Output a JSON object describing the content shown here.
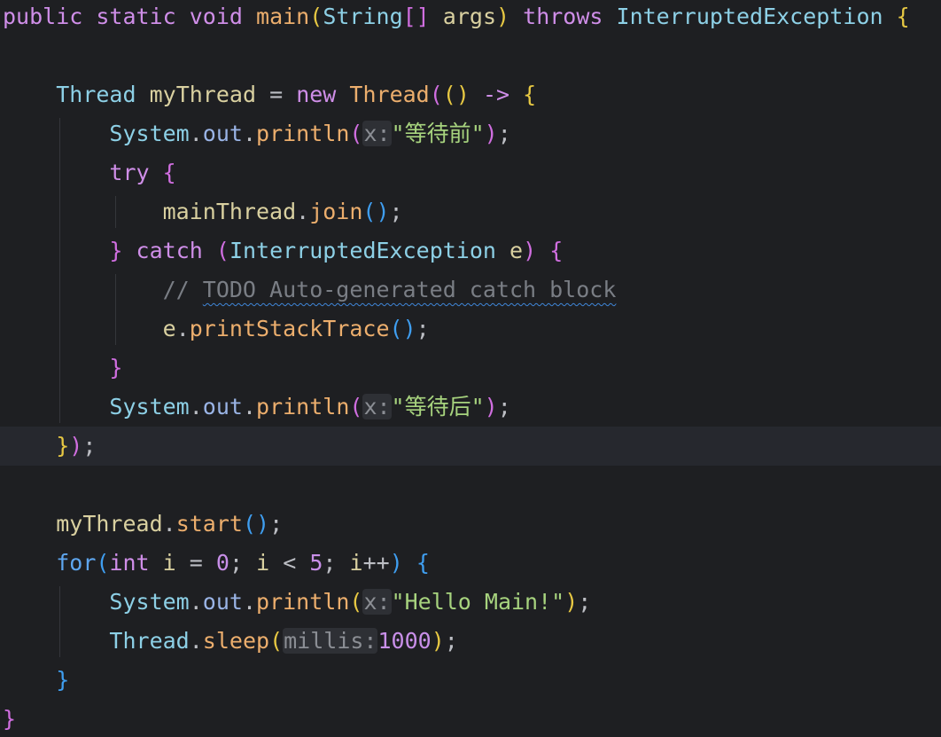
{
  "editor": {
    "language": "java",
    "theme": {
      "background": "#1e1f22",
      "current_line_background": "#26282e",
      "todo_underline": "#3f86d9"
    },
    "lines": [
      {
        "tokens": [
          {
            "t": "public",
            "c": "kw"
          },
          {
            "t": " ",
            "c": "plain"
          },
          {
            "t": "static",
            "c": "kw"
          },
          {
            "t": " ",
            "c": "plain"
          },
          {
            "t": "void",
            "c": "kw"
          },
          {
            "t": " ",
            "c": "plain"
          },
          {
            "t": "main",
            "c": "fn"
          },
          {
            "t": "(",
            "c": "b1"
          },
          {
            "t": "String",
            "c": "type"
          },
          {
            "t": "[]",
            "c": "b2"
          },
          {
            "t": " ",
            "c": "plain"
          },
          {
            "t": "args",
            "c": "var"
          },
          {
            "t": ")",
            "c": "b1"
          },
          {
            "t": " ",
            "c": "plain"
          },
          {
            "t": "throws",
            "c": "kw"
          },
          {
            "t": " ",
            "c": "plain"
          },
          {
            "t": "InterruptedException",
            "c": "type"
          },
          {
            "t": " ",
            "c": "plain"
          },
          {
            "t": "{",
            "c": "b1"
          }
        ]
      },
      {
        "tokens": []
      },
      {
        "tokens": [
          {
            "t": "    ",
            "c": "plain"
          },
          {
            "t": "Thread",
            "c": "type"
          },
          {
            "t": " ",
            "c": "plain"
          },
          {
            "t": "myThread",
            "c": "var"
          },
          {
            "t": " ",
            "c": "plain"
          },
          {
            "t": "=",
            "c": "punc"
          },
          {
            "t": " ",
            "c": "plain"
          },
          {
            "t": "new",
            "c": "kw"
          },
          {
            "t": " ",
            "c": "plain"
          },
          {
            "t": "Thread",
            "c": "fn"
          },
          {
            "t": "(",
            "c": "b2"
          },
          {
            "t": "()",
            "c": "b1"
          },
          {
            "t": " ",
            "c": "plain"
          },
          {
            "t": "->",
            "c": "kw"
          },
          {
            "t": " ",
            "c": "plain"
          },
          {
            "t": "{",
            "c": "b1"
          }
        ]
      },
      {
        "tokens": [
          {
            "t": "        ",
            "c": "plain"
          },
          {
            "t": "System",
            "c": "type"
          },
          {
            "t": ".",
            "c": "punc"
          },
          {
            "t": "out",
            "c": "fld"
          },
          {
            "t": ".",
            "c": "punc"
          },
          {
            "t": "println",
            "c": "fn"
          },
          {
            "t": "(",
            "c": "b2"
          },
          {
            "t": "x:",
            "c": "hint"
          },
          {
            "t": "\"等待前\"",
            "c": "str"
          },
          {
            "t": ")",
            "c": "b2"
          },
          {
            "t": ";",
            "c": "punc"
          }
        ]
      },
      {
        "tokens": [
          {
            "t": "        ",
            "c": "plain"
          },
          {
            "t": "try",
            "c": "kw"
          },
          {
            "t": " ",
            "c": "plain"
          },
          {
            "t": "{",
            "c": "b2"
          }
        ]
      },
      {
        "tokens": [
          {
            "t": "            ",
            "c": "plain"
          },
          {
            "t": "mainThread",
            "c": "var"
          },
          {
            "t": ".",
            "c": "punc"
          },
          {
            "t": "join",
            "c": "fn"
          },
          {
            "t": "()",
            "c": "b3"
          },
          {
            "t": ";",
            "c": "punc"
          }
        ]
      },
      {
        "tokens": [
          {
            "t": "        ",
            "c": "plain"
          },
          {
            "t": "}",
            "c": "b2"
          },
          {
            "t": " ",
            "c": "plain"
          },
          {
            "t": "catch",
            "c": "kw"
          },
          {
            "t": " ",
            "c": "plain"
          },
          {
            "t": "(",
            "c": "b2"
          },
          {
            "t": "InterruptedException",
            "c": "type"
          },
          {
            "t": " ",
            "c": "plain"
          },
          {
            "t": "e",
            "c": "var"
          },
          {
            "t": ")",
            "c": "b2"
          },
          {
            "t": " ",
            "c": "plain"
          },
          {
            "t": "{",
            "c": "b2"
          }
        ]
      },
      {
        "tokens": [
          {
            "t": "            ",
            "c": "plain"
          },
          {
            "t": "// ",
            "c": "cmt"
          },
          {
            "t": "TODO Auto-generated catch block",
            "c": "todo"
          }
        ]
      },
      {
        "tokens": [
          {
            "t": "            ",
            "c": "plain"
          },
          {
            "t": "e",
            "c": "var"
          },
          {
            "t": ".",
            "c": "punc"
          },
          {
            "t": "printStackTrace",
            "c": "fn"
          },
          {
            "t": "()",
            "c": "b3"
          },
          {
            "t": ";",
            "c": "punc"
          }
        ]
      },
      {
        "tokens": [
          {
            "t": "        ",
            "c": "plain"
          },
          {
            "t": "}",
            "c": "b2"
          }
        ]
      },
      {
        "tokens": [
          {
            "t": "        ",
            "c": "plain"
          },
          {
            "t": "System",
            "c": "type"
          },
          {
            "t": ".",
            "c": "punc"
          },
          {
            "t": "out",
            "c": "fld"
          },
          {
            "t": ".",
            "c": "punc"
          },
          {
            "t": "println",
            "c": "fn"
          },
          {
            "t": "(",
            "c": "b2"
          },
          {
            "t": "x:",
            "c": "hint"
          },
          {
            "t": "\"等待后\"",
            "c": "str"
          },
          {
            "t": ")",
            "c": "b2"
          },
          {
            "t": ";",
            "c": "punc"
          }
        ]
      },
      {
        "current": true,
        "tokens": [
          {
            "t": "    ",
            "c": "plain"
          },
          {
            "t": "}",
            "c": "b1"
          },
          {
            "t": ")",
            "c": "b2"
          },
          {
            "t": ";",
            "c": "punc"
          }
        ]
      },
      {
        "tokens": []
      },
      {
        "tokens": [
          {
            "t": "    ",
            "c": "plain"
          },
          {
            "t": "myThread",
            "c": "var"
          },
          {
            "t": ".",
            "c": "punc"
          },
          {
            "t": "start",
            "c": "fn"
          },
          {
            "t": "()",
            "c": "b3"
          },
          {
            "t": ";",
            "c": "punc"
          }
        ]
      },
      {
        "tokens": [
          {
            "t": "    ",
            "c": "plain"
          },
          {
            "t": "for",
            "c": "kwb"
          },
          {
            "t": "(",
            "c": "b3"
          },
          {
            "t": "int",
            "c": "kw"
          },
          {
            "t": " ",
            "c": "plain"
          },
          {
            "t": "i",
            "c": "var"
          },
          {
            "t": " ",
            "c": "plain"
          },
          {
            "t": "=",
            "c": "punc"
          },
          {
            "t": " ",
            "c": "plain"
          },
          {
            "t": "0",
            "c": "num"
          },
          {
            "t": ";",
            "c": "punc"
          },
          {
            "t": " ",
            "c": "plain"
          },
          {
            "t": "i",
            "c": "var"
          },
          {
            "t": " ",
            "c": "plain"
          },
          {
            "t": "<",
            "c": "punc"
          },
          {
            "t": " ",
            "c": "plain"
          },
          {
            "t": "5",
            "c": "num"
          },
          {
            "t": ";",
            "c": "punc"
          },
          {
            "t": " ",
            "c": "plain"
          },
          {
            "t": "i",
            "c": "var"
          },
          {
            "t": "++",
            "c": "punc"
          },
          {
            "t": ")",
            "c": "b3"
          },
          {
            "t": " ",
            "c": "plain"
          },
          {
            "t": "{",
            "c": "b3"
          }
        ]
      },
      {
        "tokens": [
          {
            "t": "        ",
            "c": "plain"
          },
          {
            "t": "System",
            "c": "type"
          },
          {
            "t": ".",
            "c": "punc"
          },
          {
            "t": "out",
            "c": "fld"
          },
          {
            "t": ".",
            "c": "punc"
          },
          {
            "t": "println",
            "c": "fn"
          },
          {
            "t": "(",
            "c": "b1"
          },
          {
            "t": "x:",
            "c": "hint"
          },
          {
            "t": "\"Hello Main!\"",
            "c": "str"
          },
          {
            "t": ")",
            "c": "b1"
          },
          {
            "t": ";",
            "c": "punc"
          }
        ]
      },
      {
        "tokens": [
          {
            "t": "        ",
            "c": "plain"
          },
          {
            "t": "Thread",
            "c": "type"
          },
          {
            "t": ".",
            "c": "punc"
          },
          {
            "t": "sleep",
            "c": "fn"
          },
          {
            "t": "(",
            "c": "b1"
          },
          {
            "t": "millis:",
            "c": "hint"
          },
          {
            "t": "1000",
            "c": "num"
          },
          {
            "t": ")",
            "c": "b1"
          },
          {
            "t": ";",
            "c": "punc"
          }
        ]
      },
      {
        "tokens": [
          {
            "t": "    ",
            "c": "plain"
          },
          {
            "t": "}",
            "c": "b3"
          }
        ]
      },
      {
        "tokens": [
          {
            "t": "}",
            "c": "b2"
          }
        ]
      }
    ]
  }
}
